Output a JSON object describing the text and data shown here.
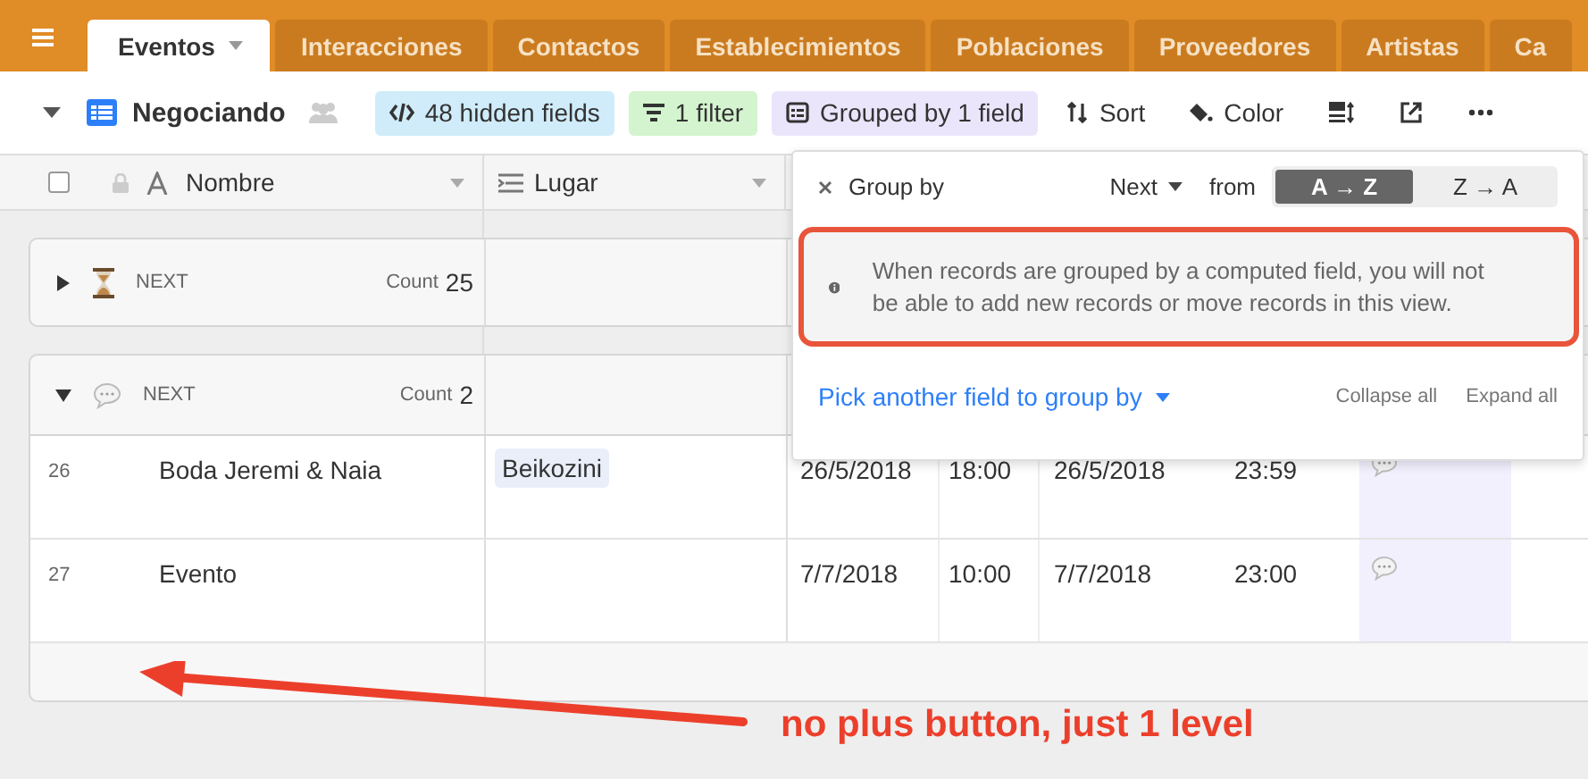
{
  "header": {
    "tabs": [
      {
        "label": "Eventos",
        "selected": true
      },
      {
        "label": "Interacciones",
        "selected": false
      },
      {
        "label": "Contactos",
        "selected": false
      },
      {
        "label": "Establecimientos",
        "selected": false
      },
      {
        "label": "Poblaciones",
        "selected": false
      },
      {
        "label": "Proveedores",
        "selected": false
      },
      {
        "label": "Artistas",
        "selected": false
      },
      {
        "label": "Ca",
        "selected": false
      }
    ]
  },
  "toolbar": {
    "view_name": "Negociando",
    "hidden_fields": "48 hidden fields",
    "filter": "1 filter",
    "group": "Grouped by 1 field",
    "sort": "Sort",
    "color_label": "Color"
  },
  "select_all": {
    "checked": false
  },
  "columns": [
    "Nombre",
    "Lugar"
  ],
  "groups": [
    {
      "kind": "hourglass",
      "label": "NEXT",
      "count_label": "Count",
      "count": "25",
      "expanded": false
    },
    {
      "kind": "comment",
      "label": "NEXT",
      "count_label": "Count",
      "count": "2",
      "expanded": true,
      "records": [
        {
          "number": "26",
          "name": "Boda Jeremi & Naia",
          "place": "Beikozini",
          "start_date": "26/5/2018",
          "start_time": "18:00",
          "end_date": "26/5/2018",
          "end_time": "23:59"
        },
        {
          "number": "27",
          "name": "Evento",
          "start_date": "7/7/2018",
          "start_time": "10:00",
          "end_date": "7/7/2018",
          "end_time": "23:00"
        }
      ]
    }
  ],
  "popup": {
    "title": "Group by",
    "field": "Next",
    "from": "from",
    "options": [
      {
        "label": "A → Z",
        "selected": true
      },
      {
        "label": "Z → A",
        "selected": false
      }
    ],
    "notice": "When records are grouped by a computed field, you will not be able to add new records or move records in this view.",
    "pick": "Pick another field to group by",
    "collapse": "Collapse all",
    "expand": "Expand all"
  },
  "annotation": {
    "text": "no plus button, just 1 level"
  }
}
